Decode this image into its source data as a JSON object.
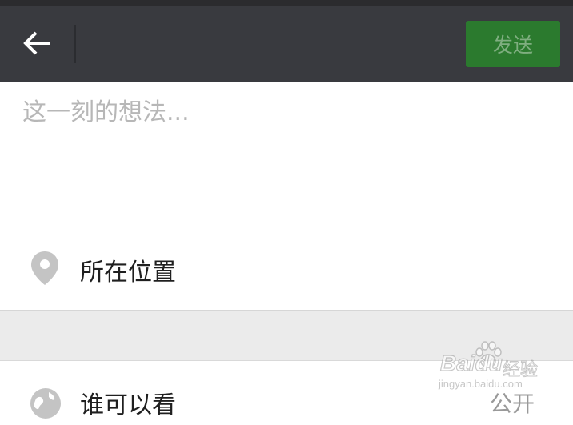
{
  "topbar": {
    "back_icon": "arrow-left-icon",
    "send_label": "发送"
  },
  "compose": {
    "value": "",
    "placeholder": "这一刻的想法..."
  },
  "location": {
    "icon": "location-pin-icon",
    "label": "所在位置"
  },
  "visibility": {
    "icon": "globe-icon",
    "label": "谁可以看",
    "value": "公开"
  },
  "watermark": {
    "logo_text": "Baidu",
    "cn_text": "经验",
    "sub_text": "jingyan.baidu.com"
  },
  "colors": {
    "topbar_bg": "#393a3f",
    "send_bg": "#2b7a2e",
    "send_text": "#7fae80",
    "gap_bg": "#ebebeb"
  }
}
